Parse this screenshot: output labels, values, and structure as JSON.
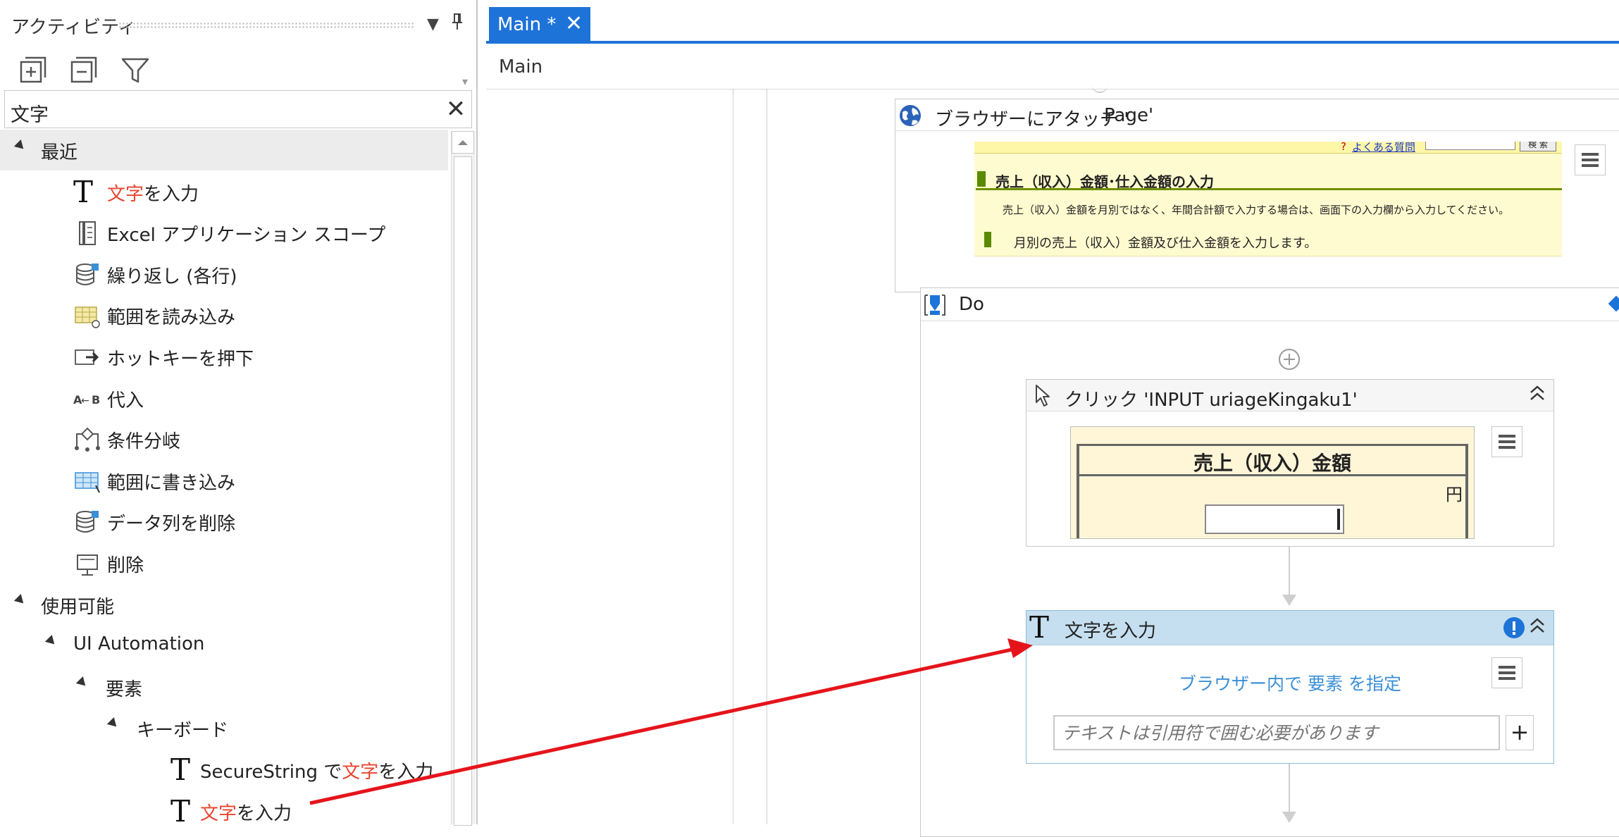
{
  "panel": {
    "title": "アクティビティ",
    "search_value": "文字",
    "search_clear": "✕"
  },
  "tree": [
    {
      "kind": "group",
      "label": "最近"
    },
    {
      "kind": "item",
      "icon": "type-into-icon",
      "pre": "",
      "hl": "文字",
      "post": "を入力"
    },
    {
      "kind": "item",
      "icon": "excel-scope-icon",
      "pre": "Excel アプリケーション スコープ",
      "hl": "",
      "post": ""
    },
    {
      "kind": "item",
      "icon": "database-loop-icon",
      "pre": "繰り返し (各行)",
      "hl": "",
      "post": ""
    },
    {
      "kind": "item",
      "icon": "read-range-icon",
      "pre": "範囲を読み込み",
      "hl": "",
      "post": ""
    },
    {
      "kind": "item",
      "icon": "hotkey-icon",
      "pre": "ホットキーを押下",
      "hl": "",
      "post": ""
    },
    {
      "kind": "item",
      "icon": "assign-icon",
      "pre": "代入",
      "hl": "",
      "post": ""
    },
    {
      "kind": "item",
      "icon": "if-icon",
      "pre": "条件分岐",
      "hl": "",
      "post": ""
    },
    {
      "kind": "item",
      "icon": "write-range-icon",
      "pre": "範囲に書き込み",
      "hl": "",
      "post": ""
    },
    {
      "kind": "item",
      "icon": "database-delete-icon",
      "pre": "データ列を削除",
      "hl": "",
      "post": ""
    },
    {
      "kind": "item",
      "icon": "delete-icon",
      "pre": "削除",
      "hl": "",
      "post": ""
    },
    {
      "kind": "group",
      "label": "使用可能"
    },
    {
      "kind": "subgroup",
      "label": "UI Automation"
    },
    {
      "kind": "subgroup2",
      "label": "要素"
    },
    {
      "kind": "subgroup3",
      "label": "キーボード"
    },
    {
      "kind": "leaf",
      "icon": "type-secure-text-icon",
      "pre": "SecureString で",
      "hl": "文字",
      "post": "を入力"
    },
    {
      "kind": "leaf",
      "icon": "type-into-icon",
      "pre": "",
      "hl": "文字",
      "post": "を入力"
    }
  ],
  "designer": {
    "tab_label": "Main *",
    "tab_close": "✕",
    "breadcrumb": "Main",
    "attach": {
      "title_left": "ブラウザーにアタッチ '",
      "title_right": "Page'",
      "shot_heading": "売上（収入）金額･仕入金額の入力",
      "shot_note": "売上（収入）金額を月別ではなく、年間合計額で入力する場合は、画面下の入力欄から入力してください。",
      "shot_sub": "月別の売上（収入）金額及び仕入金額を入力します。",
      "shot_link": "よくある質問",
      "shot_btn": "検 索"
    },
    "do": {
      "title": "Do"
    },
    "click": {
      "title": "クリック 'INPUT  uriageKingaku1'",
      "shot_heading": "売上（収入）金額",
      "shot_unit": "円"
    },
    "type": {
      "title": "文字を入力",
      "target_pre": "ブラウザー内で",
      "target_link": "要素",
      "target_post": "を指定",
      "placeholder": "テキストは引用符で囲む必要があります",
      "plus": "+"
    }
  },
  "colors": {
    "accent": "#1e73d8",
    "highlight": "#e8452d",
    "selected_header": "#c5dff0",
    "arrow": "#e5141b",
    "info": "#1e73d8"
  }
}
